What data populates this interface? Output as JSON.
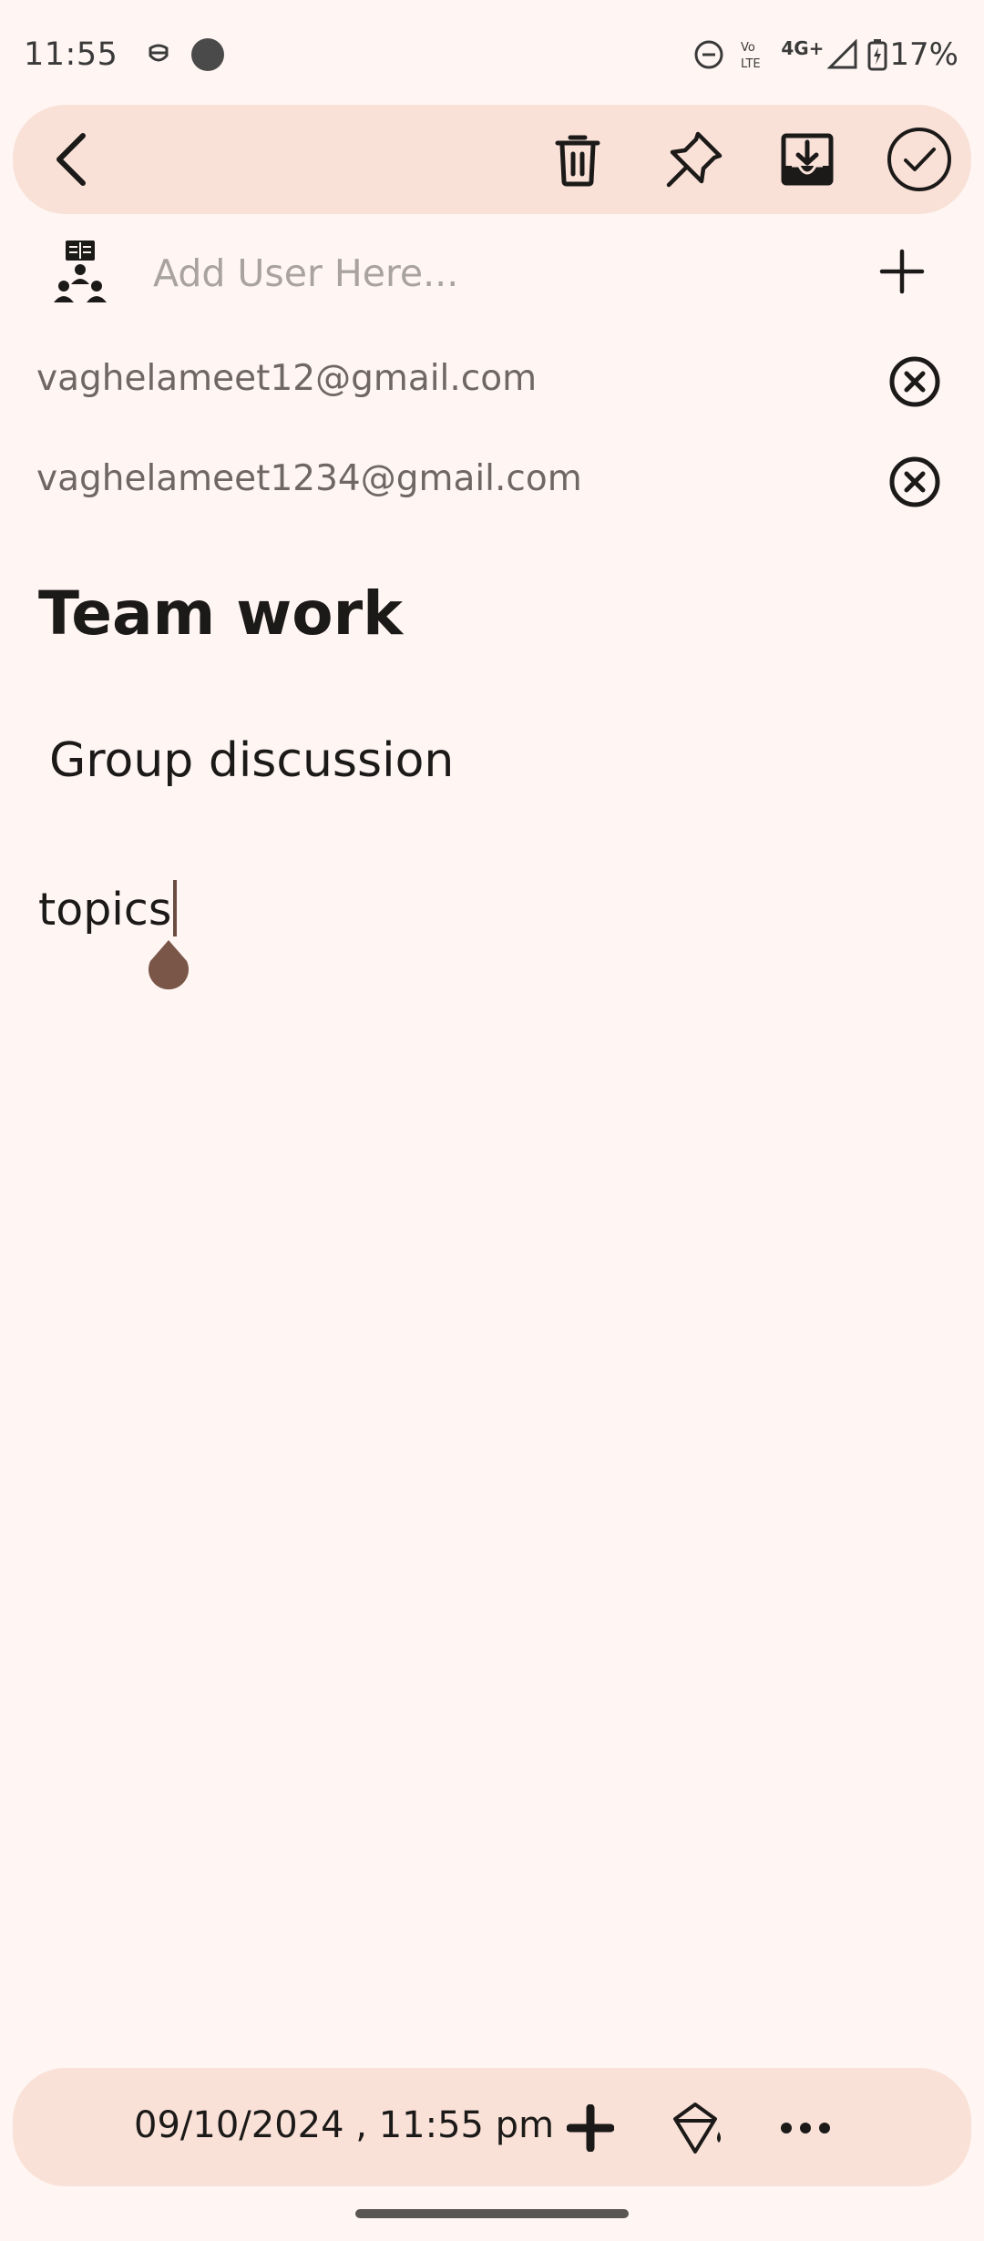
{
  "status_bar": {
    "time": "11:55",
    "battery": "17%",
    "network": "4G+"
  },
  "toolbar": {
    "icons": [
      "back-arrow-icon",
      "trash-icon",
      "pin-icon",
      "save-download-icon",
      "check-circle-icon"
    ]
  },
  "add_user": {
    "placeholder": "Add User Here...",
    "value": ""
  },
  "users": [
    {
      "email": "vaghelameet12@gmail.com"
    },
    {
      "email": "vaghelameet1234@gmail.com"
    }
  ],
  "note": {
    "title": "Team work",
    "subtitle": "Group discussion",
    "body": "topics"
  },
  "bottom_bar": {
    "timestamp": "09/10/2024 , 11:55 pm"
  },
  "colors": {
    "background": "#fff6f3",
    "bar": "#f9e1d7",
    "caret": "#6a4c40"
  }
}
